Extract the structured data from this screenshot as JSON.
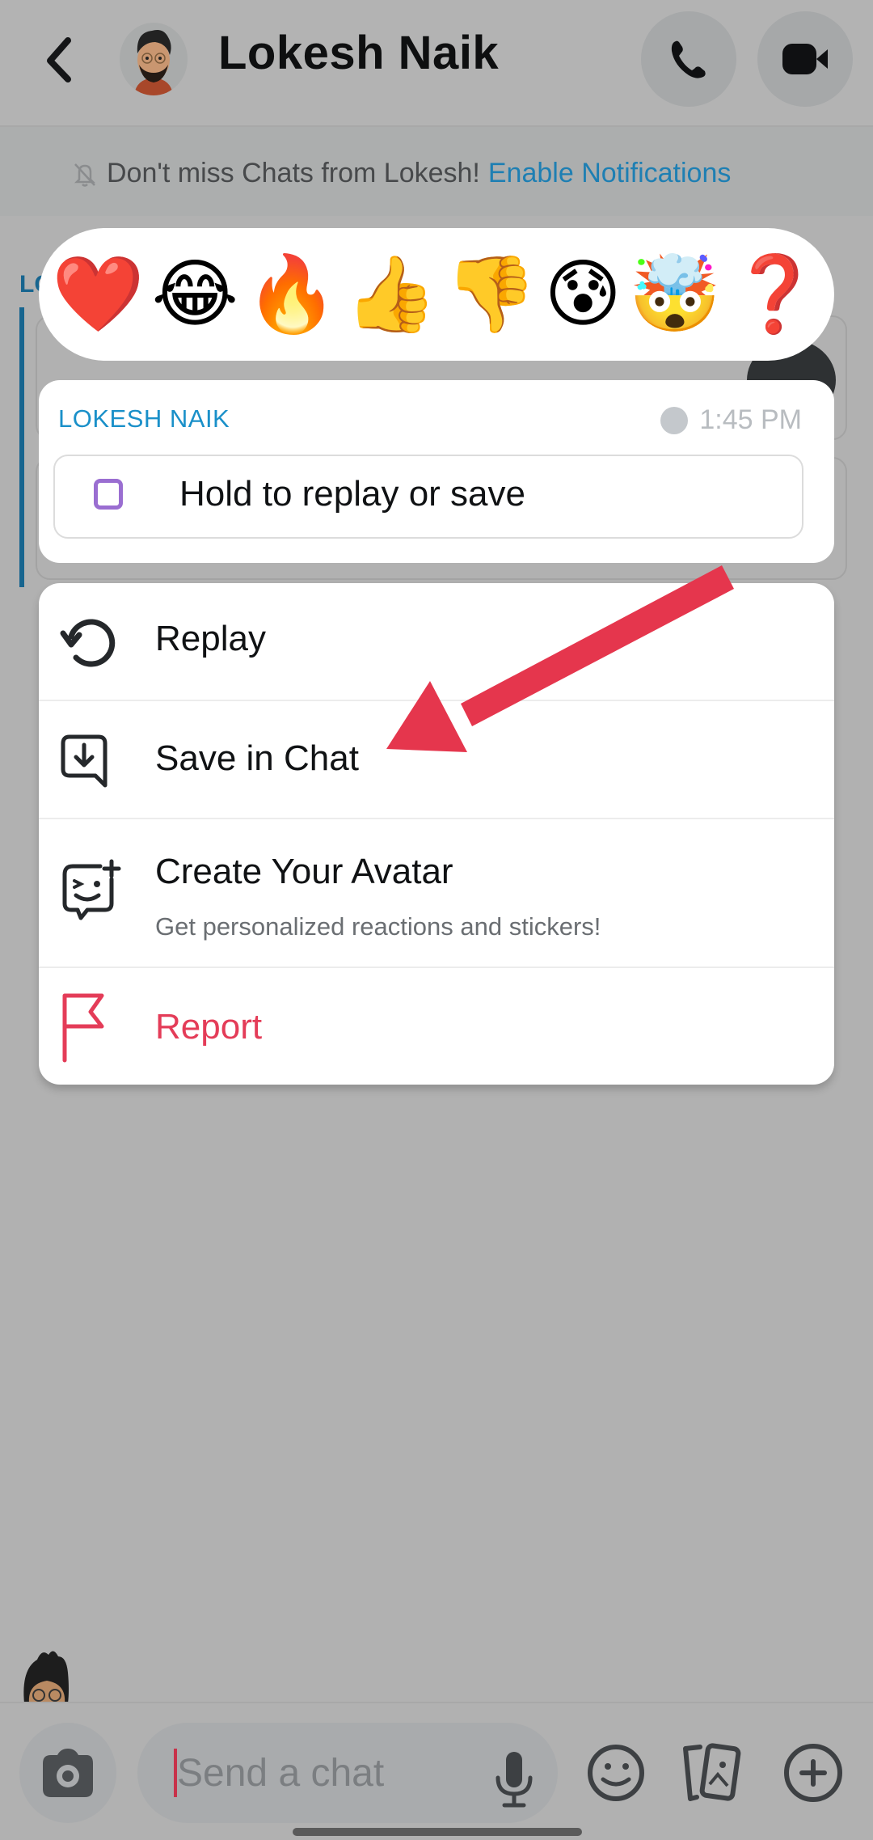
{
  "header": {
    "title": "Lokesh Naik",
    "back_icon": "chevron-left-icon",
    "avatar_icon": "bitmoji-avatar",
    "call_icon": "phone-icon",
    "video_icon": "video-camera-icon"
  },
  "notification_banner": {
    "icon": "bell-off-icon",
    "text": "Don't miss Chats from Lokesh!",
    "link": "Enable Notifications"
  },
  "background_chat": {
    "sender_partial": "LO",
    "message_partial": "Hold to replay or save"
  },
  "reactions": [
    {
      "name": "heart",
      "glyph": "❤️"
    },
    {
      "name": "tears-of-joy",
      "glyph": "😂"
    },
    {
      "name": "fire",
      "glyph": "🔥"
    },
    {
      "name": "thumbs-up",
      "glyph": "👍"
    },
    {
      "name": "thumbs-down",
      "glyph": "👎"
    },
    {
      "name": "anxious-sweat",
      "glyph": "😰"
    },
    {
      "name": "exploding-head",
      "glyph": "🤯"
    },
    {
      "name": "question-mark",
      "glyph": "❓"
    }
  ],
  "message_preview": {
    "sender": "LOKESH NAIK",
    "time": "1:45 PM",
    "text": "Hold to replay or save"
  },
  "menu": {
    "items": [
      {
        "label": "Replay",
        "icon": "replay-icon"
      },
      {
        "label": "Save in Chat",
        "icon": "save-in-chat-icon"
      },
      {
        "label": "Create Your Avatar",
        "sublabel": "Get personalized reactions and stickers!",
        "icon": "create-avatar-icon"
      },
      {
        "label": "Report",
        "icon": "flag-icon",
        "color": "#e43c58"
      }
    ]
  },
  "composer": {
    "placeholder": "Send a chat",
    "value": ""
  },
  "colors": {
    "accent_blue": "#1a90c9",
    "link_blue": "#1e7fb3",
    "report_red": "#e43c58",
    "annotation_arrow": "#e5364d",
    "overlay_gray": "#b1b1b1"
  }
}
